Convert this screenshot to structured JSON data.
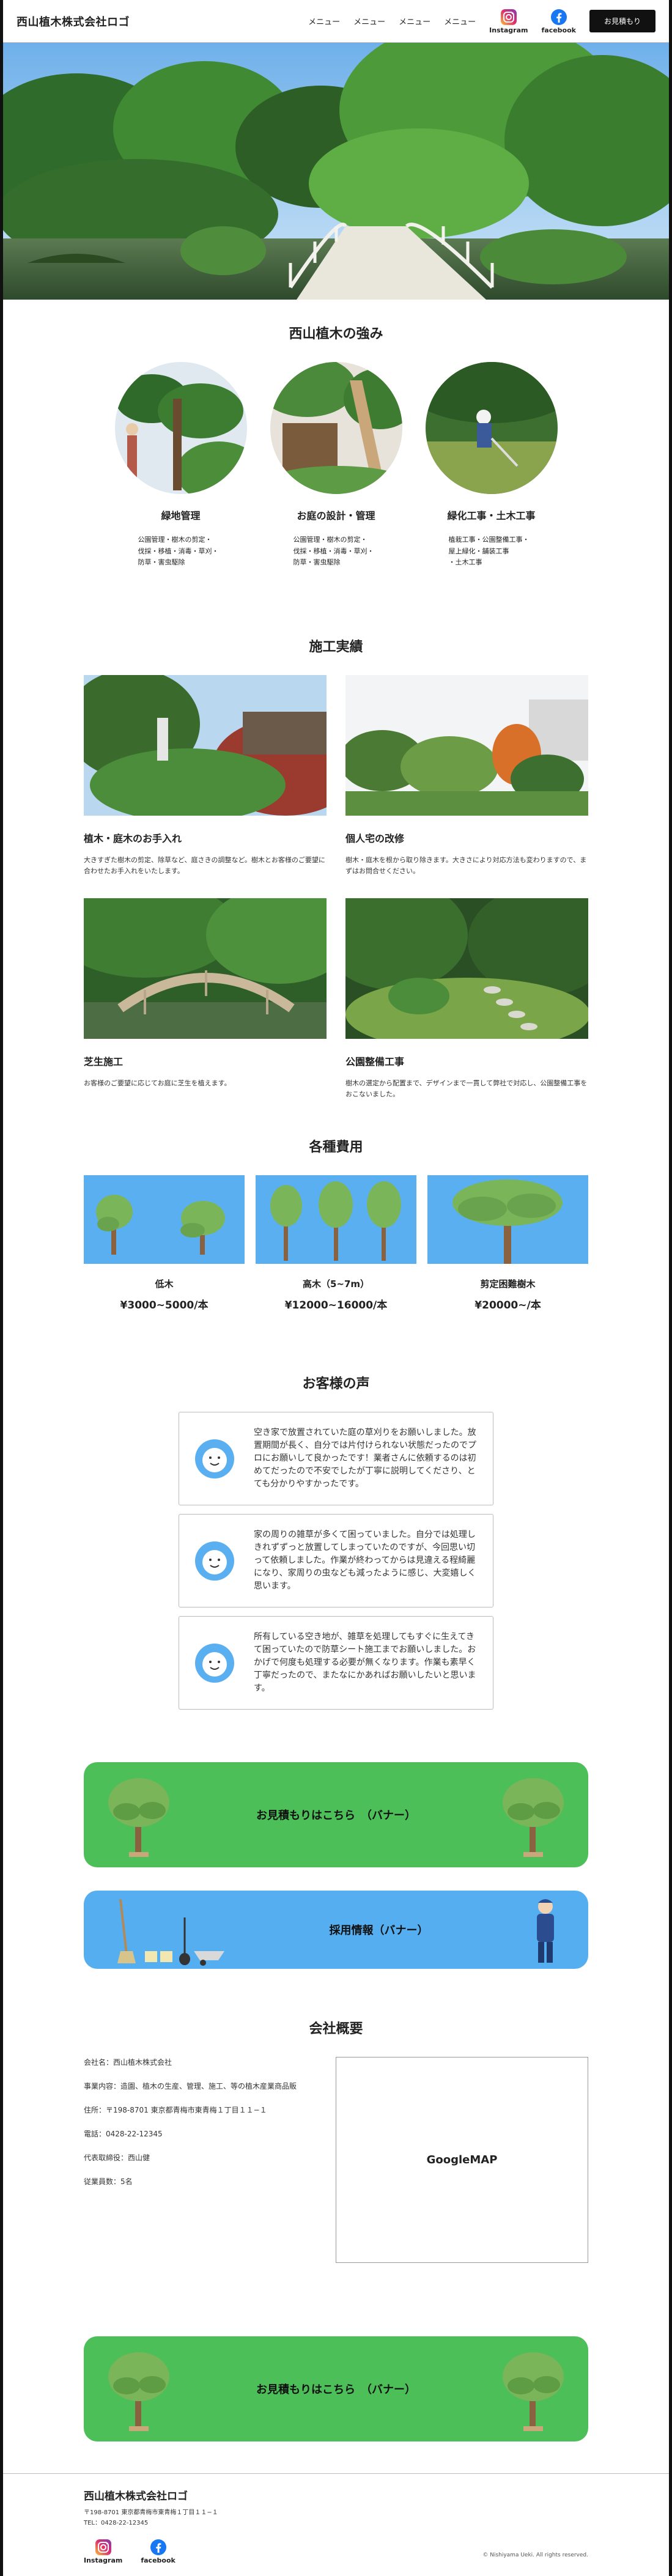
{
  "header": {
    "logo": "西山植木株式会社ロゴ",
    "nav": [
      "メニュー",
      "メニュー",
      "メニュー",
      "メニュー"
    ],
    "instagram_label": "Instagram",
    "facebook_label": "facebook",
    "cta_label": "お見積もり"
  },
  "strengths": {
    "title": "西山植木の強み",
    "items": [
      {
        "title": "緑地管理",
        "text": "公園管理・樹木の剪定・\n伐採・移植・消毒・草刈・\n防草・害虫駆除"
      },
      {
        "title": "お庭の設計・管理",
        "text": "公園管理・樹木の剪定・\n伐採・移植・消毒・草刈・\n防草・害虫駆除"
      },
      {
        "title": "緑化工事・土木工事",
        "text": "植栽工事・公園整備工事・\n屋上緑化・舗装工事\n・土木工事"
      }
    ]
  },
  "works": {
    "title": "施工実績",
    "items": [
      {
        "title": "植木・庭木のお手入れ",
        "text": "大きすぎた樹木の剪定、除草など、庭さきの調整など。樹木とお客様のご要望に合わせたお手入れをいたします。"
      },
      {
        "title": "個人宅の改修",
        "text": "樹木・庭木を根から取り除きます。大きさにより対応方法も変わりますので、まずはお問合せください。"
      },
      {
        "title": "芝生施工",
        "text": "お客様のご要望に応じてお庭に芝生を植えます。"
      },
      {
        "title": "公園整備工事",
        "text": "樹木の選定から配置まで、デザインまで一貫して弊社で対応し、公園整備工事をおこないました。"
      }
    ]
  },
  "prices": {
    "title": "各種費用",
    "items": [
      {
        "name": "低木",
        "price": "¥3000~5000/本"
      },
      {
        "name": "高木（5~7m）",
        "price": "¥12000~16000/本"
      },
      {
        "name": "剪定困難樹木",
        "price": "¥20000~/本"
      }
    ]
  },
  "voices": {
    "title": "お客様の声",
    "items": [
      "空き家で放置されていた庭の草刈りをお願いしました。放置期間が長く、自分では片付けられない状態だったのでプロにお願いして良かったです！業者さんに依頼するのは初めてだったので不安でしたが丁寧に説明してくださり、とても分かりやすかったです。",
      "家の周りの雑草が多くて困っていました。自分では処理しきれずずっと放置してしまっていたのですが、今回思い切って依頼しました。作業が終わってからは見違える程綺麗になり、家周りの虫なども減ったように感じ、大変嬉しく思います。",
      "所有している空き地が、雑草を処理してもすぐに生えてきて困っていたので防草シート施工までお願いしました。おかげで何度も処理する必要が無くなります。作業も素早く丁寧だったので、またなにかあればお願いしたいと思います。"
    ]
  },
  "banners": {
    "estimate": "お見積もりはこちら　（バナー）",
    "recruit": "採用情報（バナー）"
  },
  "company": {
    "title": "会社概要",
    "rows": [
      "会社名：西山植木株式会社",
      "事業内容：造園、植木の生産、管理、施工、等の植木産業商品販",
      "住所：〒198-8701 東京都青梅市東青梅１丁目１１−１",
      "電話：0428-22-12345",
      "代表取締役：西山健",
      "従業員数：5名"
    ],
    "map_label": "GoogleMAP"
  },
  "footer": {
    "logo": "西山植木株式会社ロゴ",
    "address": "〒198-8701 東京都青梅市東青梅１丁目１１−１",
    "tel": "TEL：0428-22-12345",
    "instagram_label": "Instagram",
    "facebook_label": "facebook",
    "copyright": "© Nishiyama Ueki. All rights reserved."
  }
}
